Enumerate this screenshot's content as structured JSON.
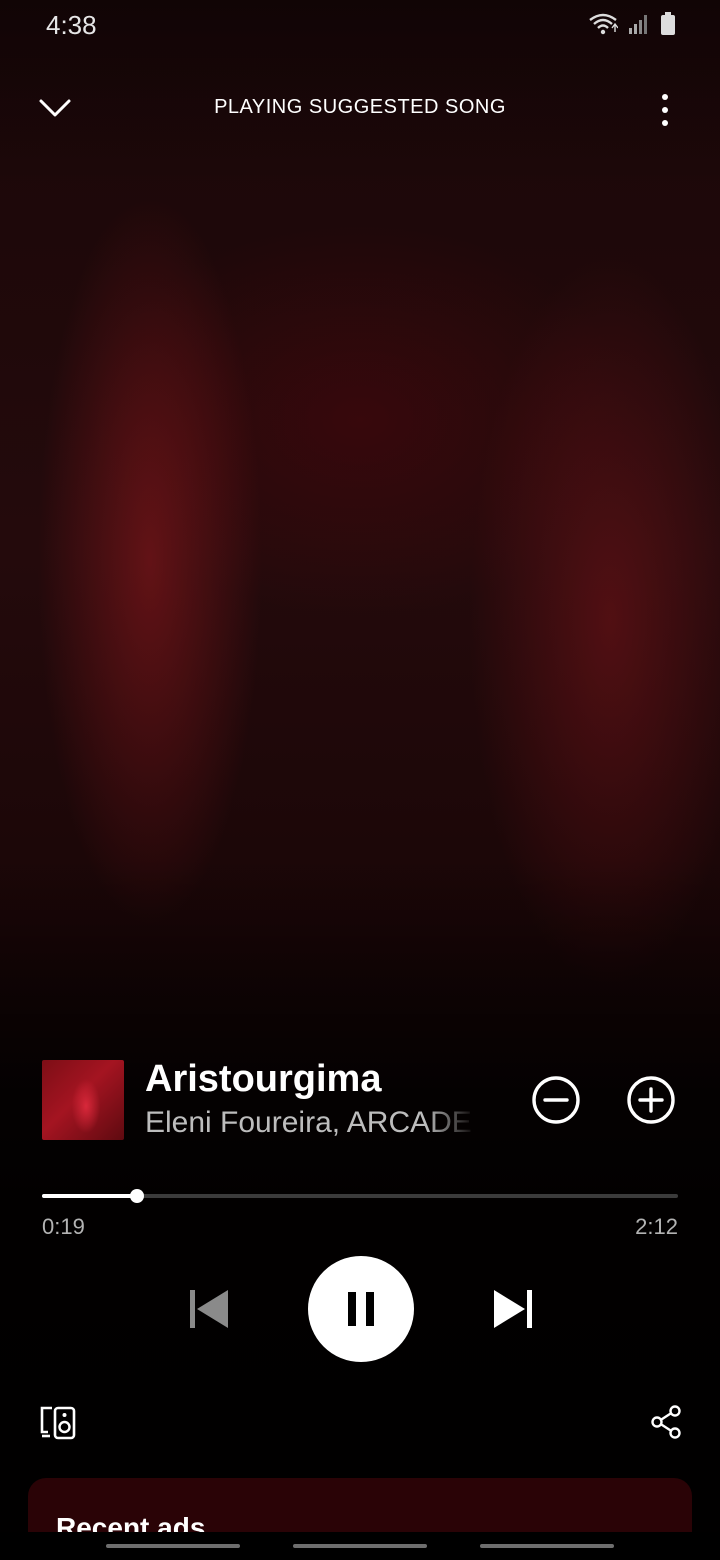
{
  "status_bar": {
    "time": "4:38"
  },
  "header": {
    "title": "PLAYING SUGGESTED SONG"
  },
  "track": {
    "title": "Aristourgima",
    "artist": "Eleni Foureira, ARCADE"
  },
  "playback": {
    "elapsed": "0:19",
    "total": "2:12",
    "progress_fraction": 0.149,
    "state": "playing"
  },
  "ads": {
    "title": "Recent ads"
  },
  "colors": {
    "accent": "#ffffff",
    "background": "#1a0708",
    "ads_card": "#2a0306",
    "secondary_text": "#b3b3b3"
  },
  "icons": {
    "collapse": "chevron-down-icon",
    "more": "more-vertical-icon",
    "remove": "minus-circle-icon",
    "add": "plus-circle-icon",
    "previous": "skip-previous-icon",
    "pause": "pause-icon",
    "next": "skip-next-icon",
    "devices": "connect-device-icon",
    "share": "share-icon"
  }
}
